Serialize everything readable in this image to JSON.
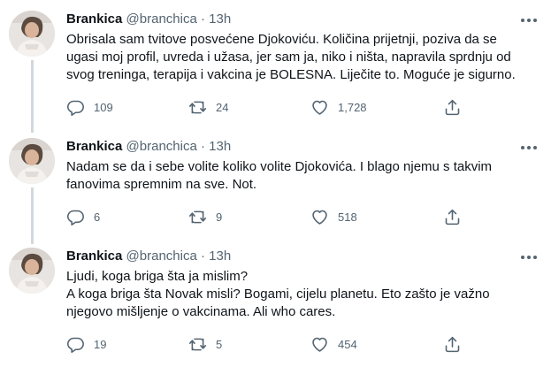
{
  "tweets": [
    {
      "name": "Brankica",
      "handle": "@branchica",
      "separator": "·",
      "time": "13h",
      "lines": [
        "Obrisala sam tvitove posvećene Djokoviću. Količina prijetnji, poziva da se",
        "ugasi moj profil, uvreda i užasa, jer sam ja, niko i ništa, napravila sprdnju od",
        "svog treninga, terapija i vakcina je BOLESNA. Liječite to. Moguće je sigurno."
      ],
      "replies": "109",
      "retweets": "24",
      "likes": "1,728"
    },
    {
      "name": "Brankica",
      "handle": "@branchica",
      "separator": "·",
      "time": "13h",
      "lines": [
        "Nadam se da i sebe volite koliko volite Djokovića. I blago njemu s takvim",
        "fanovima spremnim na sve. Not."
      ],
      "replies": "6",
      "retweets": "9",
      "likes": "518"
    },
    {
      "name": "Brankica",
      "handle": "@branchica",
      "separator": "·",
      "time": "13h",
      "lines": [
        "Ljudi, koga briga šta ja mislim?",
        "A koga briga šta Novak misli? Bogami, cijelu planetu. Eto zašto je važno",
        "njegovo mišljenje o vakcinama. Ali who cares."
      ],
      "replies": "19",
      "retweets": "5",
      "likes": "454"
    }
  ],
  "icons": {
    "reply": "reply-icon",
    "retweet": "retweet-icon",
    "like": "heart-icon",
    "share": "share-icon",
    "more": "more-icon"
  },
  "colors": {
    "text": "#0f1419",
    "muted": "#536471",
    "thread_line": "#cfd9de"
  }
}
